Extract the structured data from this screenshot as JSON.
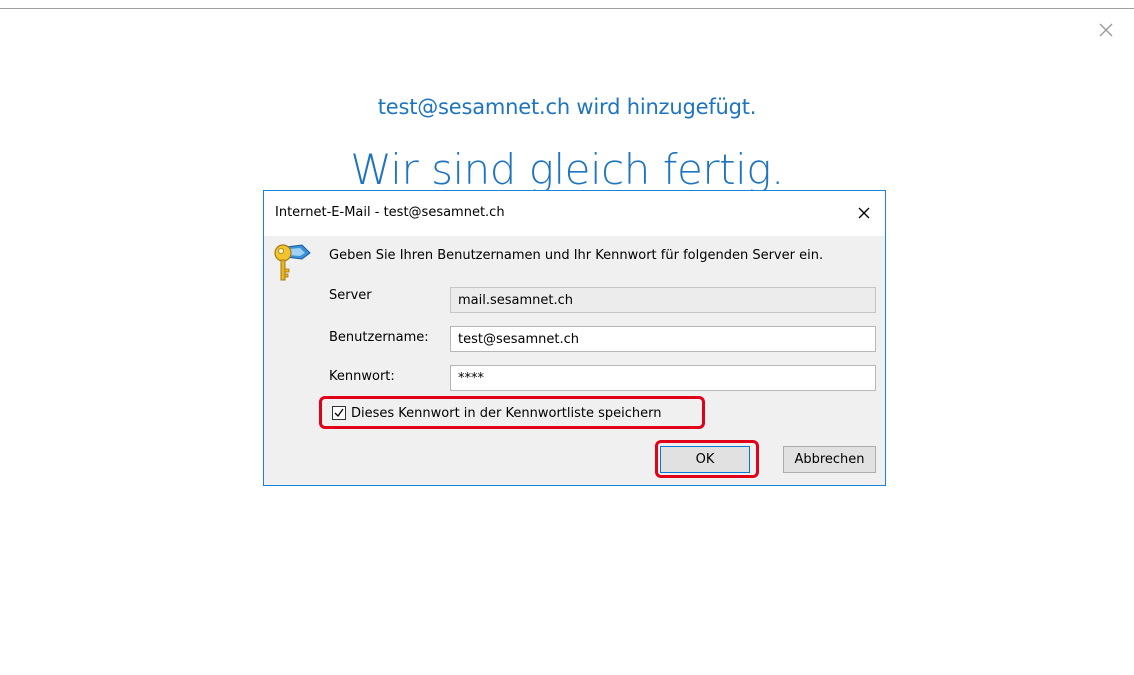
{
  "background": {
    "subtitle": "test@sesamnet.ch wird hinzugefügt.",
    "headline": "Wir sind gleich fertig.",
    "close_icon": "close-icon"
  },
  "dialog": {
    "title": "Internet-E-Mail - test@sesamnet.ch",
    "instruction": "Geben Sie Ihren Benutzernamen und Ihr Kennwort für folgenden Server ein.",
    "icon": "key-icon",
    "fields": {
      "server_label": "Server",
      "server_value": "mail.sesamnet.ch",
      "username_label": "Benutzername:",
      "username_value": "test@sesamnet.ch",
      "password_label": "Kennwort:",
      "password_value": "****"
    },
    "save_password": {
      "label": "Dieses Kennwort in der Kennwortliste speichern",
      "checked": true
    },
    "buttons": {
      "ok": "OK",
      "cancel": "Abbrechen"
    }
  },
  "colors": {
    "accent_blue": "#1e74be",
    "dialog_border": "#1883d7",
    "highlight_red": "#e0001a"
  }
}
